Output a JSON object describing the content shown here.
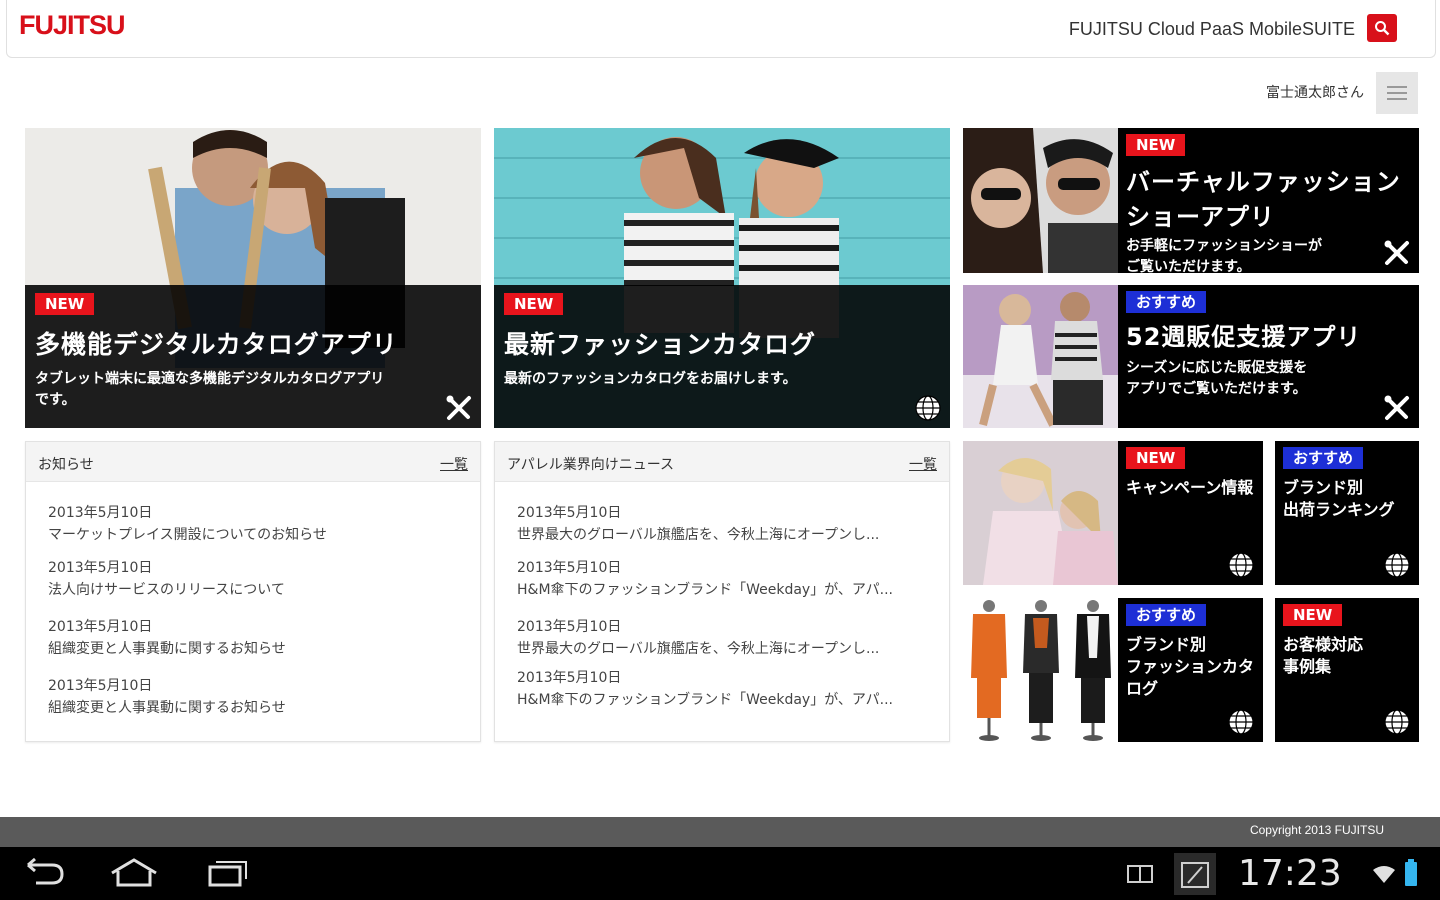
{
  "header": {
    "logo": "FUJITSU",
    "app_name": "FUJITSU Cloud PaaS MobileSUITE"
  },
  "user": {
    "name": "富士通太郎さん"
  },
  "colors": {
    "brand_red": "#d8101a",
    "badge_new": "#e8141c",
    "badge_recommended": "#1d2fd6"
  },
  "tiles": {
    "catalog_app": {
      "badge": "NEW",
      "title": "多機能デジタルカタログアプリ",
      "description_1": "タブレット端末に最適な多機能デジタルカタログアプリ",
      "description_2": "です。",
      "icon": "tools-icon"
    },
    "fashion_catalog": {
      "badge": "NEW",
      "title": "最新ファッションカタログ",
      "description_1": "最新のファッションカタログをお届けします。",
      "icon": "globe-icon"
    },
    "virtual_show": {
      "badge": "NEW",
      "title_1": "バーチャルファッション",
      "title_2": "ショーアプリ",
      "description_1": "お手軽にファッションショーが",
      "description_2": "ご覧いただけます。",
      "icon": "tools-icon"
    },
    "sales_promo": {
      "badge": "おすすめ",
      "title": "52週販促支援アプリ",
      "description_1": "シーズンに応じた販促支援を",
      "description_2": "アプリでご覧いただけます。",
      "icon": "tools-icon"
    },
    "campaign": {
      "badge": "NEW",
      "title": "キャンペーン情報",
      "icon": "globe-icon"
    },
    "ranking": {
      "badge": "おすすめ",
      "title_1": "ブランド別",
      "title_2": "出荷ランキング",
      "icon": "globe-icon"
    },
    "brand_catalog": {
      "badge": "おすすめ",
      "title_1": "ブランド別",
      "title_2": "ファッションカタ",
      "title_3": "ログ",
      "icon": "globe-icon"
    },
    "cases": {
      "badge": "NEW",
      "title_1": "お客様対応",
      "title_2": "事例集",
      "icon": "globe-icon"
    }
  },
  "news": {
    "title": "お知らせ",
    "more": "一覧",
    "items": [
      {
        "date": "2013年5月10日",
        "text": "マーケットプレイス開設についてのお知らせ"
      },
      {
        "date": "2013年5月10日",
        "text": "法人向けサービスのリリースについて"
      },
      {
        "date": "2013年5月10日",
        "text": "組織変更と人事異動に関するお知らせ"
      },
      {
        "date": "2013年5月10日",
        "text": "組織変更と人事異動に関するお知らせ"
      }
    ]
  },
  "industry_news": {
    "title": "アパレル業界向けニュース",
    "more": "一覧",
    "items": [
      {
        "date": "2013年5月10日",
        "text": "世界最大のグローバル旗艦店を、今秋上海にオープンし..."
      },
      {
        "date": "2013年5月10日",
        "text": "H&M傘下のファッションブランド「Weekday」が、アパ..."
      },
      {
        "date": "2013年5月10日",
        "text": "世界最大のグローバル旗艦店を、今秋上海にオープンし..."
      },
      {
        "date": "2013年5月10日",
        "text": "H&M傘下のファッションブランド「Weekday」が、アパ..."
      }
    ]
  },
  "footer": {
    "copyright": "Copyright 2013 FUJITSU"
  },
  "status_bar": {
    "time": "17:23"
  }
}
